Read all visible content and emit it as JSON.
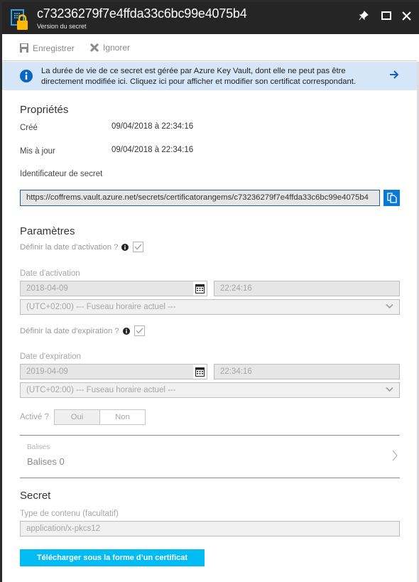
{
  "header": {
    "title": "c73236279f7e4ffda33c6bc99e4075b4",
    "subtitle": "Version du secret",
    "icons": [
      "key-vault-secret-icon",
      "pin-icon",
      "maximize-icon",
      "close-icon"
    ]
  },
  "toolbar": {
    "save_label": "Enregistrer",
    "discard_label": "Ignorer"
  },
  "info_banner": {
    "text": "La durée de vie de ce secret est gérée par Azure Key Vault, dont elle ne peut pas être directement modifiée ici. Cliquez ici pour afficher et modifier son certificat correspondant.",
    "accent": "#0a66c2",
    "background": "#d4e6f7"
  },
  "properties": {
    "title": "Propriétés",
    "created_label": "Créé",
    "created_value": "09/04/2018 à 22:34:16",
    "updated_label": "Mis à jour",
    "updated_value": "09/04/2018 à 22:34:16",
    "identifier_label": "Identificateur de secret",
    "identifier_value": "https://coffrems.vault.azure.net/secrets/certificatorangems/c73236279f7e4ffda33c6bc99e4075b4"
  },
  "settings": {
    "title": "Paramètres",
    "activation": {
      "checkbox_label": "Définir la date d'activation ?",
      "checked": true,
      "date_label": "Date d'activation",
      "date_value": "2018-04-09",
      "time_value": "22:24:16",
      "timezone_value": "(UTC+02:00) --- Fuseau horaire actuel ---"
    },
    "expiration": {
      "checkbox_label": "Définir la date d'expiration ?",
      "checked": true,
      "date_label": "Date d'expiration",
      "date_value": "2019-04-09",
      "time_value": "22:34:16",
      "timezone_value": "(UTC+02:00) --- Fuseau horaire actuel ---"
    },
    "enabled": {
      "label": "Activé ?",
      "options": [
        "Oui",
        "Non"
      ],
      "selected": "Oui"
    }
  },
  "tags": {
    "label": "Balises",
    "value": "Balises 0"
  },
  "secret": {
    "title": "Secret",
    "content_type_label": "Type de contenu (facultatif)",
    "content_type_value": "application/x-pkcs12",
    "download_label": "Télécharger sous la forme d’un certificat",
    "download_color": "#00bcf2"
  }
}
